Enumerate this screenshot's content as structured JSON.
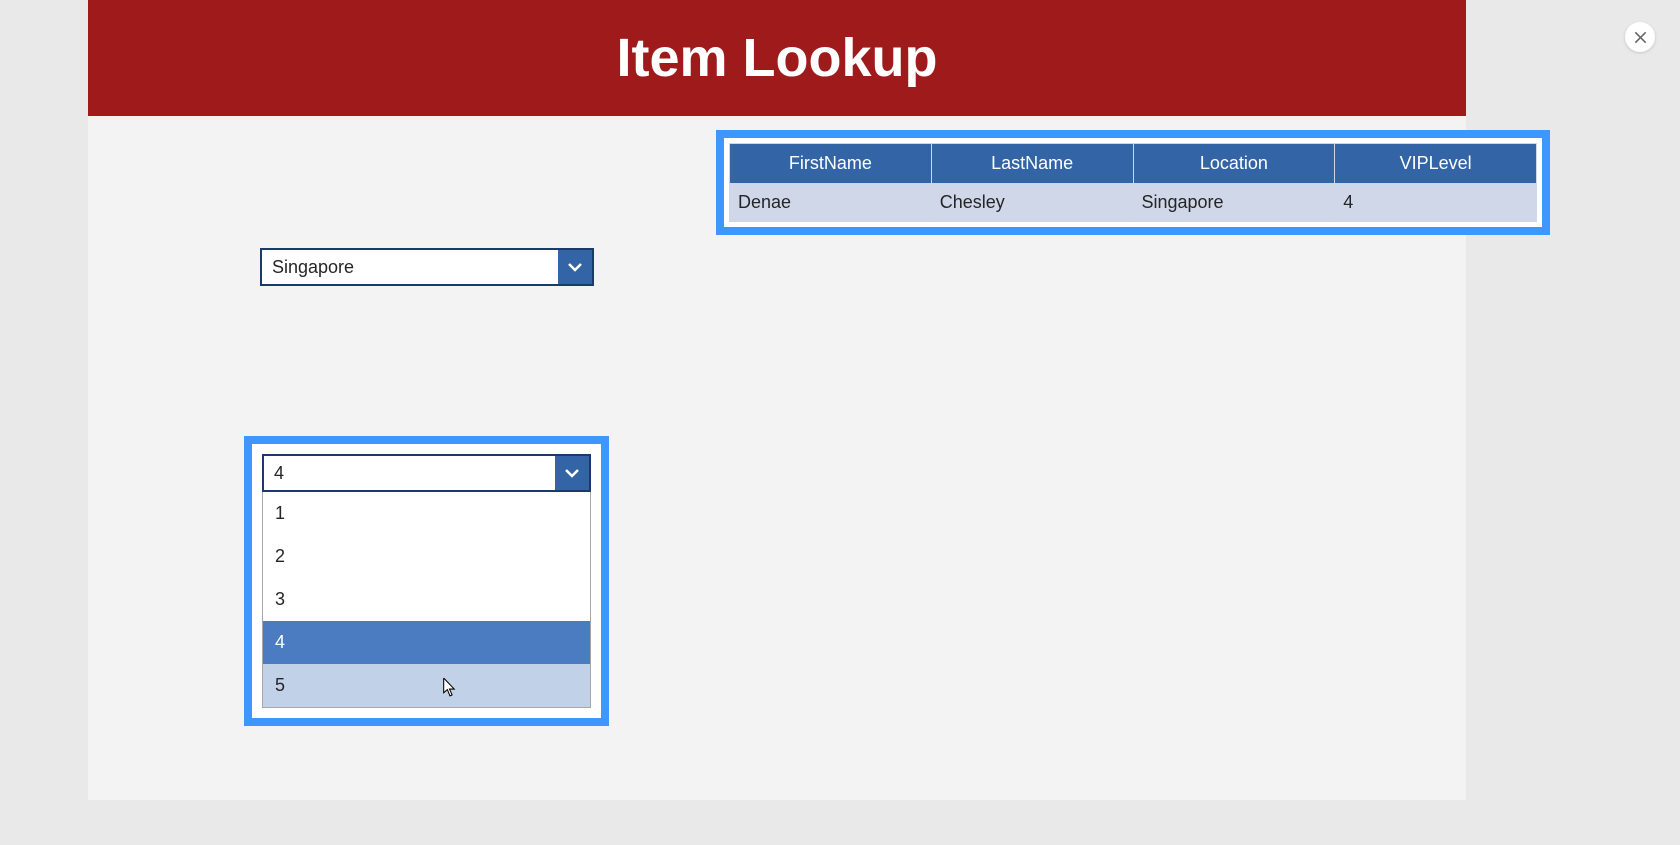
{
  "header": {
    "title": "Item Lookup"
  },
  "location_dropdown": {
    "selected_value": "Singapore"
  },
  "vip_dropdown": {
    "selected_value": "4",
    "options": [
      "1",
      "2",
      "3",
      "4",
      "5"
    ],
    "selected_index": 3,
    "hovered_index": 4
  },
  "table": {
    "headers": [
      "FirstName",
      "LastName",
      "Location",
      "VIPLevel"
    ],
    "row": {
      "first_name": "Denae",
      "last_name": "Chesley",
      "location": "Singapore",
      "vip_level": "4"
    }
  }
}
